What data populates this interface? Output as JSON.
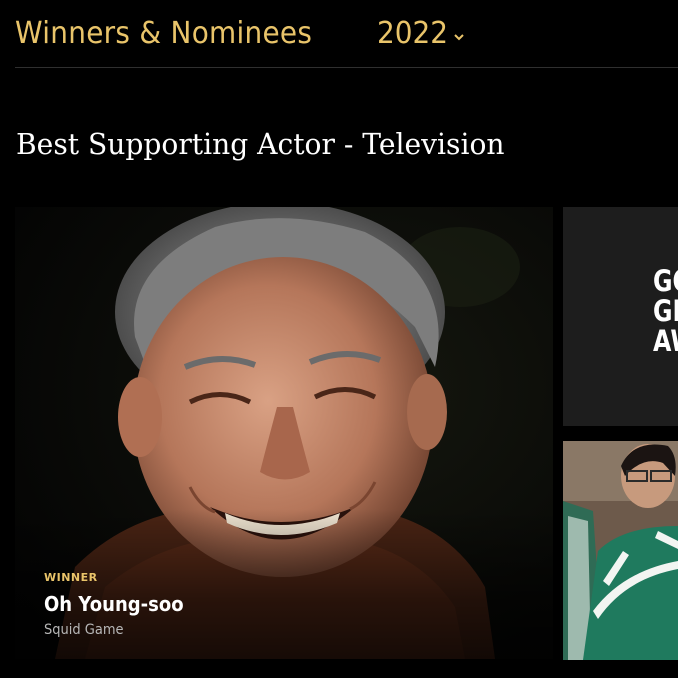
{
  "header": {
    "title": "Winners & Nominees",
    "year": "2022"
  },
  "category": {
    "title": "Best Supporting Actor - Television"
  },
  "featured": {
    "badge": "WINNER",
    "name": "Oh Young-soo",
    "show": "Squid Game"
  },
  "side_cards": [
    {
      "logo_text": "GO\nGL\nAW"
    },
    {
      "image": "squid-game-still"
    }
  ],
  "colors": {
    "accent": "#e9c46a",
    "background": "#000000",
    "card": "#1d1d1d",
    "subtext": "#b7b7b7"
  },
  "icons": [
    "chevron-down-icon"
  ]
}
